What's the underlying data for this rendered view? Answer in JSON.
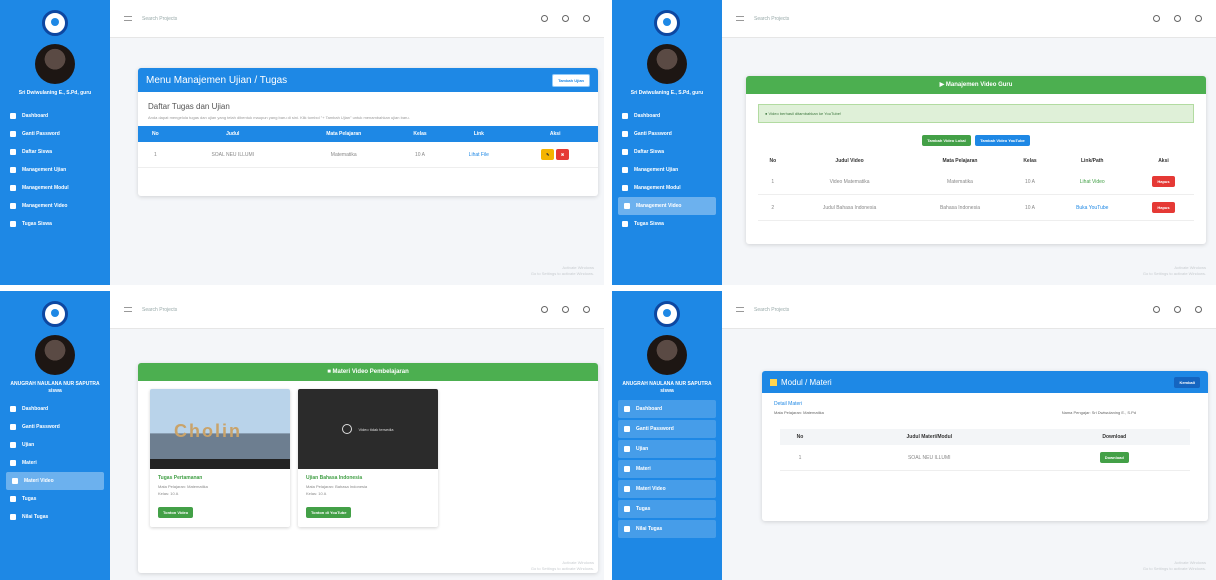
{
  "panel1": {
    "sidebar": {
      "user_name": "Sri Dwiwulaning E., S.Pd, guru",
      "items": [
        "Dashboard",
        "Ganti Password",
        "Daftar Siswa",
        "Management Ujian",
        "Management Modul",
        "Management Video",
        "Tugas Siswa"
      ]
    },
    "breadcrumb": "Search Projects",
    "card_title": "Menu Manajemen Ujian / Tugas",
    "header_button": "Tambah Ujian",
    "section_title": "Daftar Tugas dan Ujian",
    "section_desc": "Anda dapat mengelola tugas dan ujian yang telah dibentuk maupun yang baru di sini. Klik tombol \"+ Tambah Ujian\" untuk menambahkan ujian baru.",
    "columns": [
      "No",
      "Judul",
      "Mata Pelajaran",
      "Kelas",
      "Link",
      "Aksi"
    ],
    "rows": [
      [
        "1",
        "SOAL NEU ILLUMI",
        "Matematika",
        "10 A",
        "Lihat File"
      ]
    ],
    "footer": [
      "Activate Windows",
      "Go to Settings to activate Windows."
    ]
  },
  "panel2": {
    "sidebar": {
      "user_name": "Sri Dwiwulaning E., S.Pd, guru",
      "items": [
        "Dashboard",
        "Ganti Password",
        "Daftar Siswa",
        "Management Ujian",
        "Management Modul",
        "Management Video",
        "Tugas Siswa"
      ]
    },
    "breadcrumb": "Search Projects",
    "card_title": "Manajemen Video Guru",
    "alert": "Video berhasil ditambahkan ke YouTube!",
    "buttons": [
      "Tambah Video Lokal",
      "Tambah Video YouTube"
    ],
    "columns": [
      "No",
      "Judul Video",
      "Mata Pelajaran",
      "Kelas",
      "Link/Path",
      "Aksi"
    ],
    "rows": [
      [
        "1",
        "Video Matematika",
        "Matematika",
        "10 A",
        "Lihat Video",
        "Hapus"
      ],
      [
        "2",
        "Judul Bahasa Indonesia",
        "Bahasa Indonesia",
        "10 A",
        "Buka YouTube",
        "Hapus"
      ]
    ],
    "footer": [
      "Activate Windows",
      "Go to Settings to activate Windows."
    ]
  },
  "panel3": {
    "sidebar": {
      "user_name": "ANUGRAH NAULANA NUR SAPUTRA",
      "user_role": "siswa",
      "items": [
        "Dashboard",
        "Ganti Password",
        "Ujian",
        "Materi",
        "Materi Video",
        "Tugas",
        "Nilai Tugas"
      ]
    },
    "breadcrumb": "Search Projects",
    "card_title": "Materi Video Pembelajaran",
    "thumb_text": "Cholin",
    "unavailable": "Video tidak tersedia",
    "videos": [
      {
        "title": "Tugas Pertamanan",
        "subject": "Mata Pelajaran: Matematika",
        "class": "Kelas: 10 A",
        "button": "Tonton Video"
      },
      {
        "title": "Ujian Bahasa Indonesia",
        "subject": "Mata Pelajaran: Bahasa Indonesia",
        "class": "Kelas: 10 A",
        "button": "Tonton di YouTube"
      }
    ],
    "footer": [
      "Activate Windows",
      "Go to Settings to activate Windows."
    ]
  },
  "panel4": {
    "sidebar": {
      "user_name": "ANUGRAH NAULANA NUR SAPUTRA",
      "user_role": "siswa",
      "items": [
        "Dashboard",
        "Ganti Password",
        "Ujian",
        "Materi",
        "Materi Video",
        "Tugas",
        "Nilai Tugas"
      ]
    },
    "breadcrumb": "Search Projects",
    "card_title": "Modul / Materi",
    "header_button": "Kembali",
    "info_title": "Detail Materi",
    "subject": "Mata Pelajaran: Matematika",
    "teacher": "Nama Pengajar: Sri Dwiwulaning E., S.Pd",
    "columns": [
      "No",
      "Judul Materi/Modul",
      "Download"
    ],
    "rows": [
      [
        "1",
        "SOAL NEU ILLUMI",
        "Download"
      ]
    ],
    "footer": [
      "Activate Windows",
      "Go to Settings to activate Windows."
    ]
  },
  "colors": {
    "primary": "#1e88e5",
    "success": "#4caf50",
    "danger": "#e53935",
    "warning": "#f4b400"
  }
}
